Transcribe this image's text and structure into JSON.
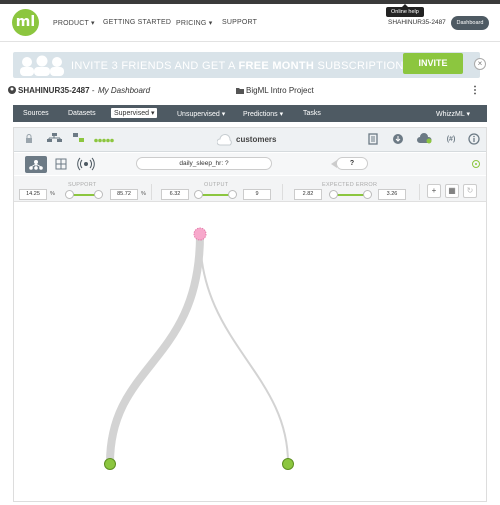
{
  "nav": {
    "logo": "ml",
    "items": [
      "PRODUCT",
      "GETTING STARTED",
      "PRICING",
      "SUPPORT"
    ],
    "username": "SHAHINUR35-2487",
    "dashboard": "Dashboard",
    "tooltip": "Online help"
  },
  "banner": {
    "text_pre": "INVITE 3 FRIENDS AND GET A",
    "text_bold": "FREE MONTH",
    "text_post": "SUBSCRIPTION",
    "invite": "INVITE",
    "close": "×"
  },
  "breadcrumb": {
    "user": "SHAHINUR35-2487",
    "sep": " - ",
    "dashboard": "My Dashboard",
    "project": "BigML Intro Project",
    "menu": "⋮"
  },
  "menu": {
    "items": [
      "Sources",
      "Datasets",
      "Supervised ▾",
      "Unsupervised ▾",
      "Predictions ▾",
      "Tasks"
    ],
    "right": "WhizzML ▾"
  },
  "toolbar": {
    "name": "customers"
  },
  "view": {
    "prediction": "daily_sleep_hr: ?",
    "question": "?"
  },
  "filters": {
    "support_label": "SUPPORT",
    "support_min": "14.25",
    "support_max": "85.72",
    "pct": "%",
    "output_label": "OUTPUT",
    "output_min": "6.32",
    "output_max": "9",
    "expected_label": "EXPECTED ERROR",
    "expected_min": "2.82",
    "expected_max": "3.26"
  },
  "colors": {
    "accent": "#8cc63f",
    "bar": "#4e5a63",
    "root": "#f7a8cb",
    "leaf": "#8cc63f",
    "branch": "#d3d3d3"
  }
}
